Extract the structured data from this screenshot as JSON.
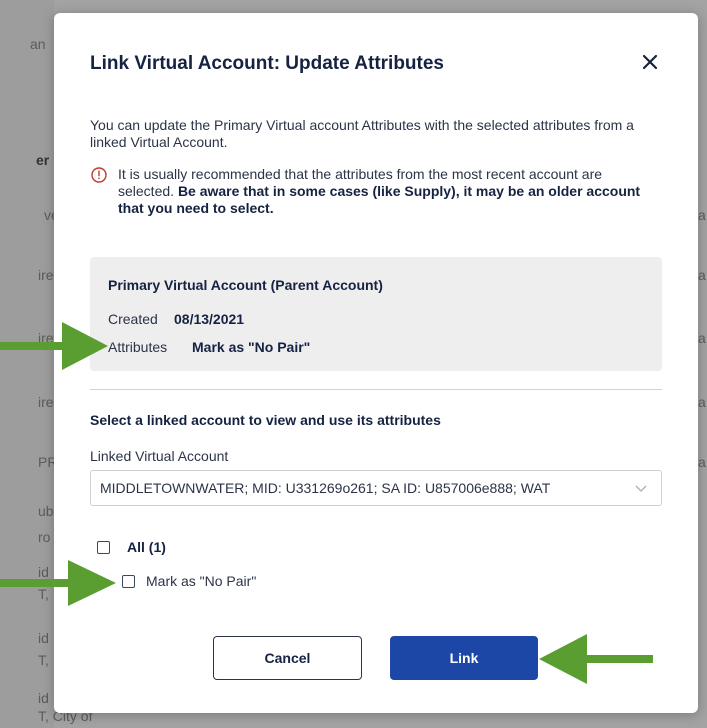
{
  "background": {
    "left_fragments": [
      "an",
      "er",
      "ve",
      "ire",
      "ire",
      "ire",
      "PR",
      "ub",
      "ro",
      "id",
      "T,",
      "id",
      "T,",
      "id",
      "T,",
      "T, City of"
    ],
    "right_fragments": [
      "a",
      "a",
      "a",
      "a",
      "a"
    ]
  },
  "modal": {
    "title": "Link Virtual Account: Update Attributes",
    "intro": "You can update the Primary Virtual account Attributes with the selected attributes from a linked Virtual Account.",
    "warning_plain": "It is usually recommended that the attributes from the most recent account are selected.",
    "warning_bold": "Be aware that in some cases (like Supply), it may be an older account that you need to select.",
    "primary_account": {
      "title": "Primary Virtual Account (Parent Account)",
      "created_label": "Created",
      "created_value": "08/13/2021",
      "attributes_label": "Attributes",
      "attributes_value": "Mark as \"No Pair\""
    },
    "section_title": "Select a linked account to view and use its attributes",
    "linked_label": "Linked Virtual Account",
    "linked_value": "MIDDLETOWNWATER; MID: U331269o261; SA ID: U857006e888; WAT",
    "all_label": "All (1)",
    "attribute_option": "Mark as \"No Pair\"",
    "cancel_label": "Cancel",
    "link_label": "Link"
  },
  "colors": {
    "accent": "#1c47a6",
    "arrow": "#5a9e32",
    "title": "#152241"
  },
  "icons": [
    "close-icon",
    "warning-icon",
    "chevron-down-icon",
    "arrow-annotation"
  ]
}
